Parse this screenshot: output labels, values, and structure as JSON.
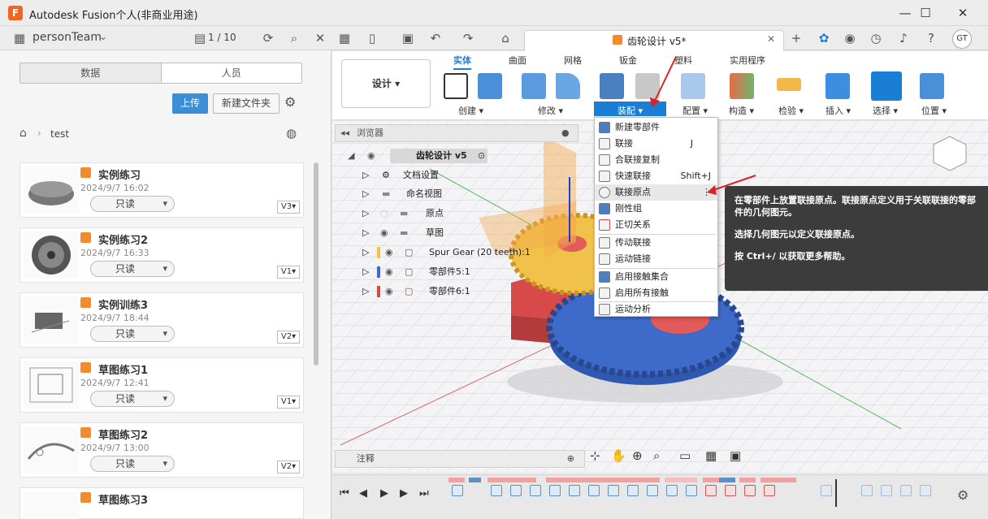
{
  "app": {
    "title": "Autodesk Fusion个人(非商业用途)",
    "logo": "F"
  },
  "window_controls": {
    "minimize": "—",
    "maximize": "☐",
    "close": "✕"
  },
  "top_bar": {
    "team": "personTeam",
    "pages": "1 / 10",
    "doc_tab": "齿轮设计 v5*",
    "avatar": "GT"
  },
  "data_panel": {
    "tabs": [
      "数据",
      "人员"
    ],
    "upload": "上传",
    "new_folder": "新建文件夹",
    "breadcrumb": "test",
    "items": [
      {
        "name": "实例练习",
        "date": "2024/9/7 16:02",
        "access": "只读",
        "version": "V3▾"
      },
      {
        "name": "实例练习2",
        "date": "2024/9/7 16:33",
        "access": "只读",
        "version": "V1▾"
      },
      {
        "name": "实例训练3",
        "date": "2024/9/7 18:44",
        "access": "只读",
        "version": "V2▾"
      },
      {
        "name": "草图练习1",
        "date": "2024/9/7 12:41",
        "access": "只读",
        "version": "V1▾"
      },
      {
        "name": "草图练习2",
        "date": "2024/9/7 13:00",
        "access": "只读",
        "version": "V2▾"
      },
      {
        "name": "草图练习3",
        "date": "",
        "access": "",
        "version": ""
      }
    ]
  },
  "toolbar": {
    "workspace": "设计 ▾",
    "tabs": [
      "实体",
      "曲面",
      "网格",
      "钣金",
      "塑料",
      "实用程序"
    ],
    "groups": [
      "创建 ▾",
      "修改 ▾",
      "装配 ▾",
      "配置 ▾",
      "构造 ▾",
      "检验 ▾",
      "插入 ▾",
      "选择 ▾",
      "位置 ▾"
    ]
  },
  "browser": {
    "title": "浏览器",
    "root": "齿轮设计 v5",
    "rows": [
      "文档设置",
      "命名视图",
      "原点",
      "草图",
      "Spur Gear (20 teeth):1",
      "零部件5:1",
      "零部件6:1"
    ]
  },
  "assemble_menu": {
    "items": [
      {
        "label": "新建零部件",
        "shortcut": ""
      },
      {
        "label": "联接",
        "shortcut": "J"
      },
      {
        "label": "合联接复制",
        "shortcut": ""
      },
      {
        "label": "快速联接",
        "shortcut": "Shift+J"
      },
      {
        "label": "联接原点",
        "shortcut": "⋮"
      },
      {
        "label": "刚性组",
        "shortcut": ""
      },
      {
        "label": "正切关系",
        "shortcut": ""
      },
      {
        "label": "传动联接",
        "shortcut": ""
      },
      {
        "label": "运动链接",
        "shortcut": ""
      },
      {
        "label": "启用接触集合",
        "shortcut": ""
      },
      {
        "label": "启用所有接触",
        "shortcut": ""
      },
      {
        "label": "运动分析",
        "shortcut": ""
      }
    ]
  },
  "tooltip": {
    "line1": "在零部件上放置联接原点。联接原点定义用于关联联接的零部件的几何图元。",
    "line2": "选择几何图元以定义联接原点。",
    "line3": "按 Ctrl+/ 以获取更多帮助。"
  },
  "status": {
    "comments": "注释"
  },
  "colors": {
    "accent": "#1a7fd4",
    "gear_blue": "#3e6bc9",
    "gear_yellow": "#f0c24a",
    "base_red": "#d84a4a"
  }
}
